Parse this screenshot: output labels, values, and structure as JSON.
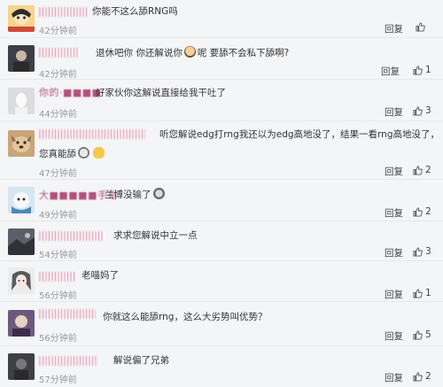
{
  "comments": [
    {
      "username": "■■■■■■■■■■",
      "text": "你能不这么舔RNG吗",
      "time": "42分钟前",
      "reply": "回复",
      "likes": "",
      "avatar": "anime-avatar"
    },
    {
      "username": "■■■■■■■■",
      "text_before_emoji": "退休吧你 你还解说你",
      "text_after_emoji": "呢 要舔不会私下舔啊?",
      "emoji": "face-emoji",
      "time": "42分钟前",
      "reply": "回复",
      "likes": "1",
      "avatar": "dark-portrait-avatar"
    },
    {
      "username": "你的·■■■■",
      "text": "好家伙你这解说直接给我干吐了",
      "time": "44分钟前",
      "reply": "回复",
      "likes": "3",
      "avatar": "white-figure-avatar"
    },
    {
      "username": "■■■■■■■■■■■■■",
      "text_line1": "听您解说edg打rng我还以为edg高地没了，结果一看rng高地没了，",
      "text_line2_before": "您真能舔",
      "emoji_1": "gray-face-emoji",
      "emoji_2": "bread-emoji",
      "time": "47分钟前",
      "reply": "回复",
      "likes": "2",
      "avatar": "dog-avatar"
    },
    {
      "username": "大■■■■■手裕",
      "text_before_emoji": "兰博没输了",
      "emoji": "mind-emoji",
      "time": "49分钟前",
      "reply": "回复",
      "likes": "2",
      "avatar": "cartoon-avatar"
    },
    {
      "username": "■■■■■■■■■■■■",
      "text": "求求您解说中立一点",
      "time": "54分钟前",
      "reply": "回复",
      "likes": "3",
      "avatar": "dark-landscape-avatar"
    },
    {
      "username": "■■■■■",
      "text": "老喵妈了",
      "time": "56分钟前",
      "reply": "回复",
      "likes": "1",
      "avatar": "anime-girl-avatar"
    },
    {
      "username": "■■■■■■■■",
      "text": "你就这么能舔rng，这么大劣势叫优势？",
      "time": "56分钟前",
      "reply": "回复",
      "likes": "5",
      "avatar": "purple-avatar"
    },
    {
      "username": "■■■■■■■■",
      "text": "解说偏了兄弟",
      "time": "57分钟前",
      "reply": "回复",
      "likes": "2",
      "avatar": "shadow-avatar"
    }
  ],
  "colors": {
    "background": "#f4f5f7",
    "username": "#b0527a",
    "time": "#999999",
    "text": "#333333"
  }
}
